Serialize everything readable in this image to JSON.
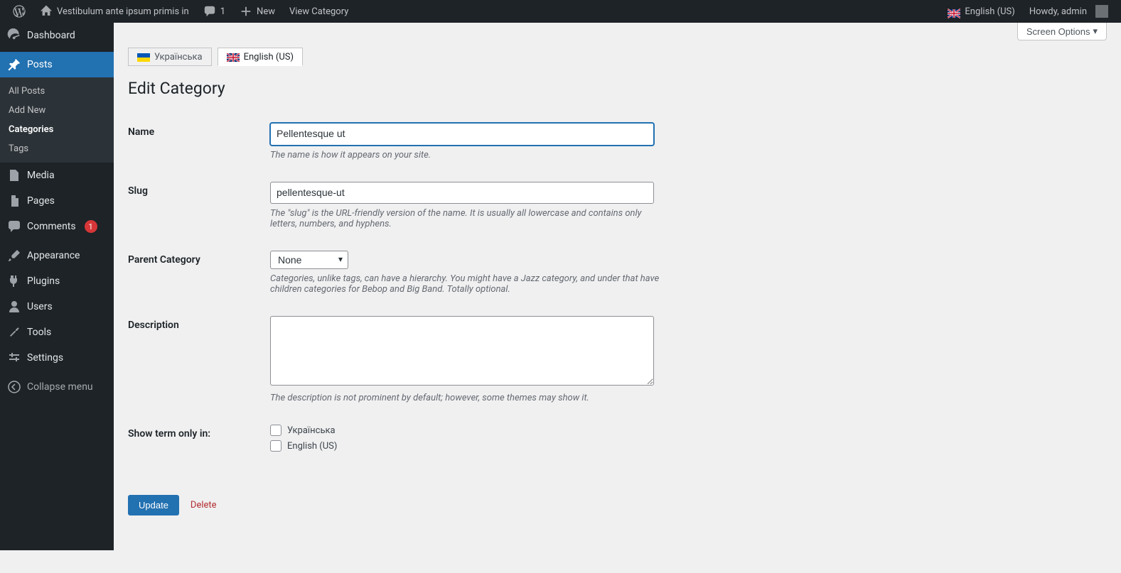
{
  "adminbar": {
    "site_title": "Vestibulum ante ipsum primis in",
    "comment_count": "1",
    "new_label": "New",
    "view_category": "View Category",
    "lang_label": "English (US)",
    "howdy": "Howdy, admin"
  },
  "sidebar": {
    "items": {
      "dashboard": "Dashboard",
      "posts": "Posts",
      "media": "Media",
      "pages": "Pages",
      "comments": "Comments",
      "comments_count": "1",
      "appearance": "Appearance",
      "plugins": "Plugins",
      "users": "Users",
      "tools": "Tools",
      "settings": "Settings",
      "collapse": "Collapse menu"
    },
    "sub_posts": {
      "all": "All Posts",
      "add": "Add New",
      "categories": "Categories",
      "tags": "Tags"
    }
  },
  "screen_options": "Screen Options",
  "lang_tabs": {
    "ua": "Українська",
    "en": "English (US)"
  },
  "page_title": "Edit Category",
  "form": {
    "name": {
      "label": "Name",
      "value": "Pellentesque ut",
      "desc": "The name is how it appears on your site."
    },
    "slug": {
      "label": "Slug",
      "value": "pellentesque-ut",
      "desc": "The \"slug\" is the URL-friendly version of the name. It is usually all lowercase and contains only letters, numbers, and hyphens."
    },
    "parent": {
      "label": "Parent Category",
      "value": "None",
      "desc": "Categories, unlike tags, can have a hierarchy. You might have a Jazz category, and under that have children categories for Bebop and Big Band. Totally optional."
    },
    "description": {
      "label": "Description",
      "value": "",
      "desc": "The description is not prominent by default; however, some themes may show it."
    },
    "show_in": {
      "label": "Show term only in:",
      "opt_ua": "Українська",
      "opt_en": "English (US)"
    }
  },
  "buttons": {
    "update": "Update",
    "delete": "Delete"
  }
}
